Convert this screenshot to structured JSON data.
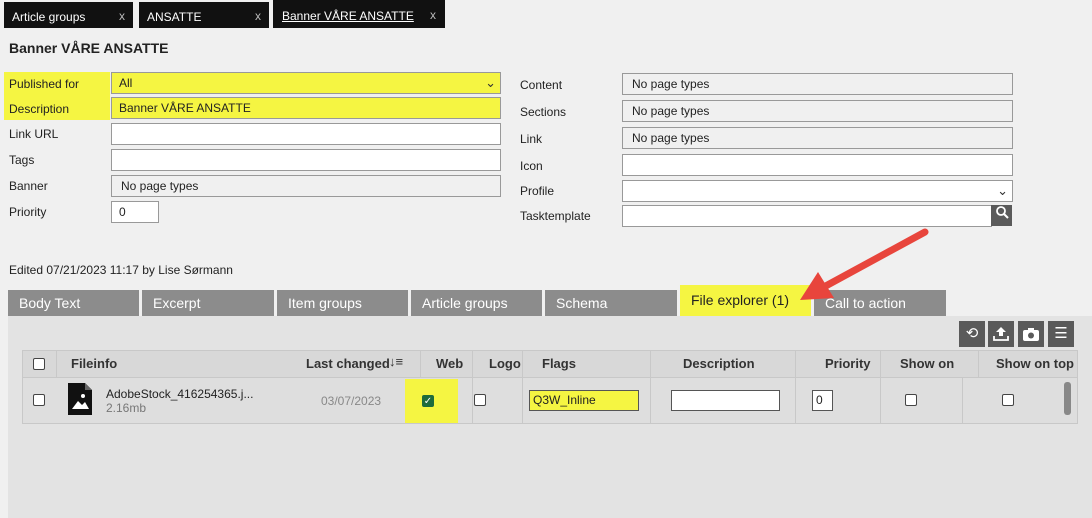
{
  "top_tabs": [
    {
      "label": "Article groups",
      "close": "x"
    },
    {
      "label": "ANSATTE",
      "close": "x"
    },
    {
      "label": "Banner VÅRE ANSATTE",
      "close": "x"
    }
  ],
  "page_title": "Banner VÅRE ANSATTE",
  "left_form": {
    "published_for": {
      "label": "Published for",
      "value": "All"
    },
    "description": {
      "label": "Description",
      "value": "Banner VÅRE ANSATTE"
    },
    "link_url": {
      "label": "Link URL",
      "value": ""
    },
    "tags": {
      "label": "Tags",
      "value": ""
    },
    "banner": {
      "label": "Banner",
      "value": "No page types"
    },
    "priority": {
      "label": "Priority",
      "value": "0"
    }
  },
  "right_form": {
    "content": {
      "label": "Content",
      "value": "No page types"
    },
    "sections": {
      "label": "Sections",
      "value": "No page types"
    },
    "link": {
      "label": "Link",
      "value": "No page types"
    },
    "icon": {
      "label": "Icon",
      "value": ""
    },
    "profile": {
      "label": "Profile",
      "value": ""
    },
    "tasktemplate": {
      "label": "Tasktemplate",
      "value": ""
    }
  },
  "edited_text": "Edited 07/21/2023 11:17 by Lise Sørmann",
  "content_tabs": [
    {
      "label": "Body Text"
    },
    {
      "label": "Excerpt"
    },
    {
      "label": "Item groups"
    },
    {
      "label": "Article groups"
    },
    {
      "label": "Schema"
    },
    {
      "label": "File explorer (1)"
    },
    {
      "label": "Call to action"
    }
  ],
  "toolbar_icons": [
    "refresh-icon",
    "upload-icon",
    "camera-icon",
    "menu-icon"
  ],
  "table": {
    "headers": {
      "fileinfo": "Fileinfo",
      "last_changed": "Last changed",
      "web": "Web",
      "logo": "Logo",
      "flags": "Flags",
      "description": "Description",
      "priority": "Priority",
      "show_on": "Show on",
      "show_on_top": "Show on top"
    },
    "rows": [
      {
        "filename": "AdobeStock_416254365.j...",
        "size": "2.16mb",
        "last_changed": "03/07/2023",
        "web": true,
        "logo": false,
        "flags": "Q3W_Inline",
        "description": "",
        "priority": "0",
        "show_on": false,
        "show_on_top": false
      }
    ]
  },
  "colors": {
    "highlight": "#f5f542",
    "dark_tab": "#111111",
    "grey_tab": "#8c8c8c",
    "arrow": "#e8453c",
    "checkbox_on": "#1e6b3c"
  }
}
